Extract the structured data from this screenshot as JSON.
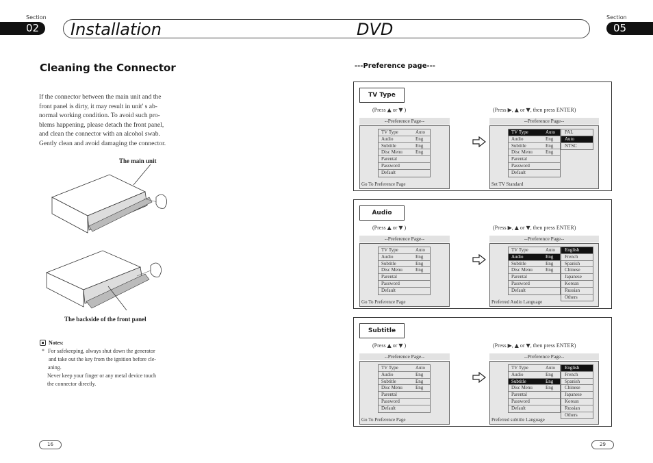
{
  "header": {
    "section_label": "Section",
    "left_section": "02",
    "right_section": "05",
    "left_title": "Installation",
    "right_title": "DVD"
  },
  "left_page": {
    "heading": "Cleaning the Connector",
    "paragraph": [
      "If the connector between the main unit and the",
      "front panel is dirty, it may result in unit' s ab-",
      "normal working condition. To avoid such pro-",
      "blems happening, please detach the front panel,",
      "and clean the connector with  an alcohol swab.",
      "Gently clean and avoid damaging the connector."
    ],
    "figure1_caption": "The main unit",
    "figure2_caption": "The backside of the front panel",
    "notes_label": "Notes:",
    "notes_bullet": "*",
    "notes": [
      "For safekeeping, always shut down the generator",
      "and take out the key from the ignition before cle-",
      "aning.",
      "Never keep your finger or any metal device touch",
      "the connector directly."
    ],
    "page_number": "16"
  },
  "right_page": {
    "heading": "---Preference page---",
    "page_number": "29",
    "screen_title": "--Preference Page--",
    "hint_left": {
      "pre": "(Press",
      "mid": "or",
      "post": ")"
    },
    "hint_right": {
      "pre": "(Press",
      "sep": ",",
      "mid": "or",
      "post": ", then press ENTER)"
    },
    "menu": [
      {
        "key": "TV Type",
        "value": "Auto"
      },
      {
        "key": "Audio",
        "value": "Eng"
      },
      {
        "key": "Subtitle",
        "value": "Eng"
      },
      {
        "key": "Disc Menu",
        "value": "Eng"
      },
      {
        "key": "Parental",
        "value": ""
      },
      {
        "key": "Password",
        "value": ""
      },
      {
        "key": "Default",
        "value": ""
      }
    ],
    "left_status": "Go To Preference Page",
    "sections": [
      {
        "tag": "TV Type",
        "selected_index": 0,
        "options": [
          "PAL",
          "Auto",
          "NTSC"
        ],
        "selected_option": 1,
        "status": "Set TV Standard"
      },
      {
        "tag": "Audio",
        "selected_index": 1,
        "options": [
          "English",
          "French",
          "Spanish",
          "Chinese",
          "Japanese",
          "Korean",
          "Russian",
          "Others"
        ],
        "selected_option": 0,
        "status": "Preferred Audio Language"
      },
      {
        "tag": "Subtitle",
        "selected_index": 2,
        "options": [
          "English",
          "French",
          "Spanish",
          "Chinese",
          "Japanese",
          "Korean",
          "Russian",
          "Others"
        ],
        "selected_option": 0,
        "status": "Preferred subtitle Language"
      }
    ]
  }
}
